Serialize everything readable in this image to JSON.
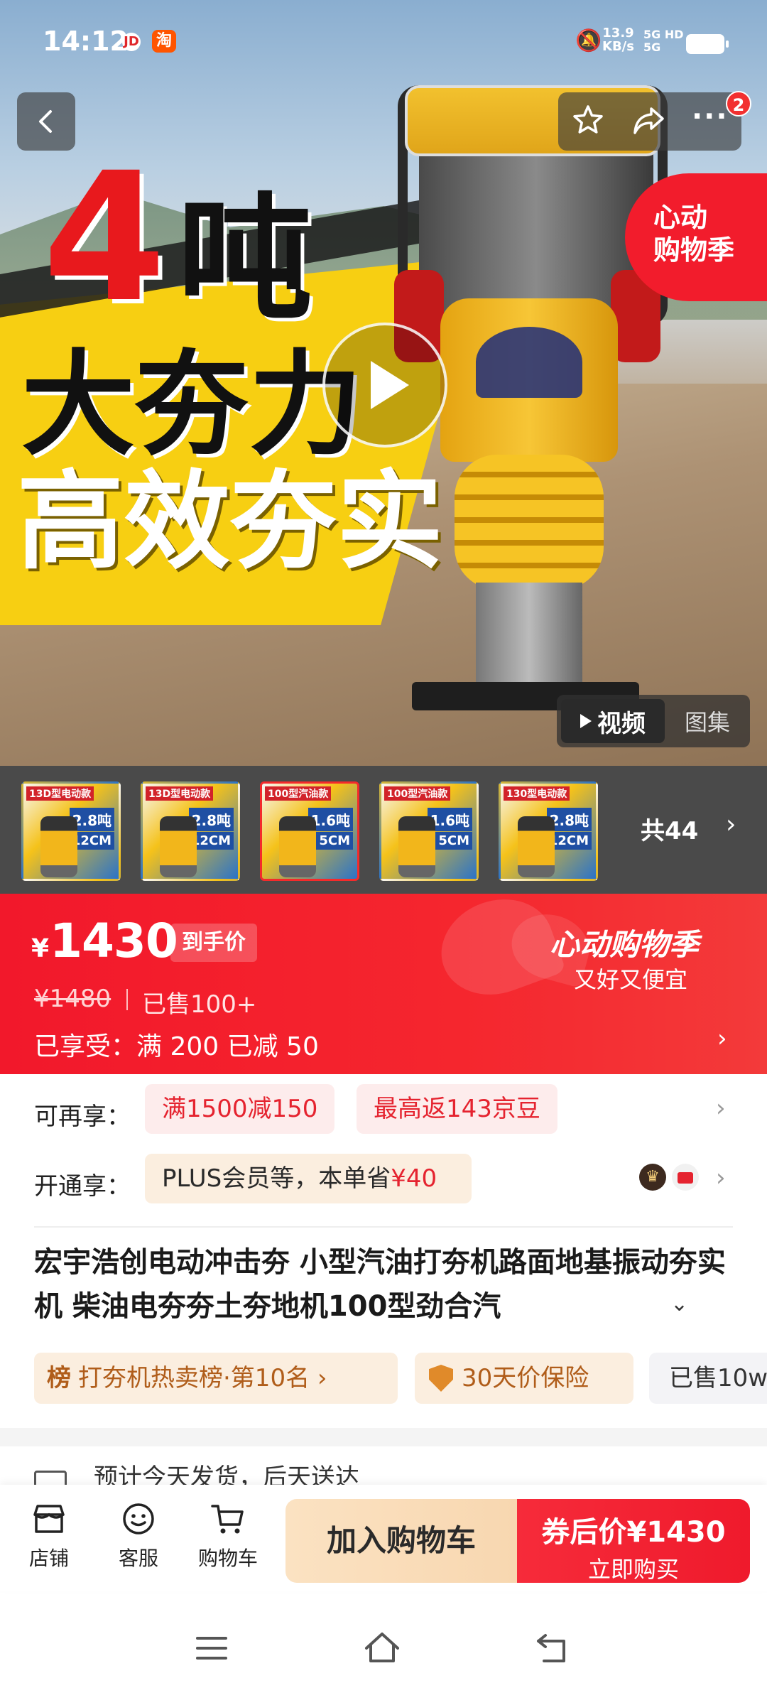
{
  "status_bar": {
    "time": "14:12",
    "app_badges": [
      "JD",
      "淘"
    ],
    "net_speed_value": "13.9",
    "net_speed_unit": "KB/s",
    "signal_label_1": "5G HD",
    "signal_label_2": "5G"
  },
  "notification_count": "2",
  "hero": {
    "line1_number": "4",
    "line1_text": "吨",
    "line2": "大夯力",
    "line3": "高效夯实",
    "promo_badge": "心动\n购物季",
    "video_label": "视频",
    "gallery_label": "图集"
  },
  "thumbs": {
    "count_label": "共44",
    "items": [
      {
        "tag": "13D型电动款",
        "v1": "2.8吨",
        "v2": "12CM"
      },
      {
        "tag": "13D型电动款",
        "v1": "2.8吨",
        "v2": "12CM"
      },
      {
        "tag": "100型汽油款",
        "v1": "1.6吨",
        "v2": "5CM"
      },
      {
        "tag": "100型汽油款",
        "v1": "1.6吨",
        "v2": "5CM"
      },
      {
        "tag": "130型电动款",
        "v1": "2.8吨",
        "v2": "12CM"
      }
    ]
  },
  "price": {
    "currency": "¥",
    "amount": "1430",
    "tag": "到手价",
    "original": "¥1480",
    "sold": "已售100+",
    "enjoyed": "已享受：满 200 已减 50",
    "promo_title": "心动购物季",
    "promo_sub": "又好又便宜"
  },
  "offers": {
    "row1_label": "可再享：",
    "row1_chip1": "满1500减150",
    "row1_chip2": "最高返143京豆",
    "row2_label": "开通享：",
    "row2_chip_text": "PLUS会员等，本单省",
    "row2_chip_value": "¥40"
  },
  "product": {
    "title": "宏宇浩创电动冲击夯 小型汽油打夯机路面地基振动夯实机 柴油电夯夯土夯地机100型劲合汽",
    "rank_icon": "榜",
    "rank": "打夯机热卖榜·第10名",
    "insurance": "30天价保险",
    "sold_chip": "已售10w"
  },
  "shipping": {
    "text": "预计今天发货，后天送达"
  },
  "bottom_bar": {
    "store": "店铺",
    "service": "客服",
    "cart": "购物车",
    "add_to_cart": "加入购物车",
    "buy_line1": "券后价¥1430",
    "buy_line2": "立即购买"
  },
  "colors": {
    "brand_red": "#f2182b",
    "cream": "#fbeedf"
  }
}
